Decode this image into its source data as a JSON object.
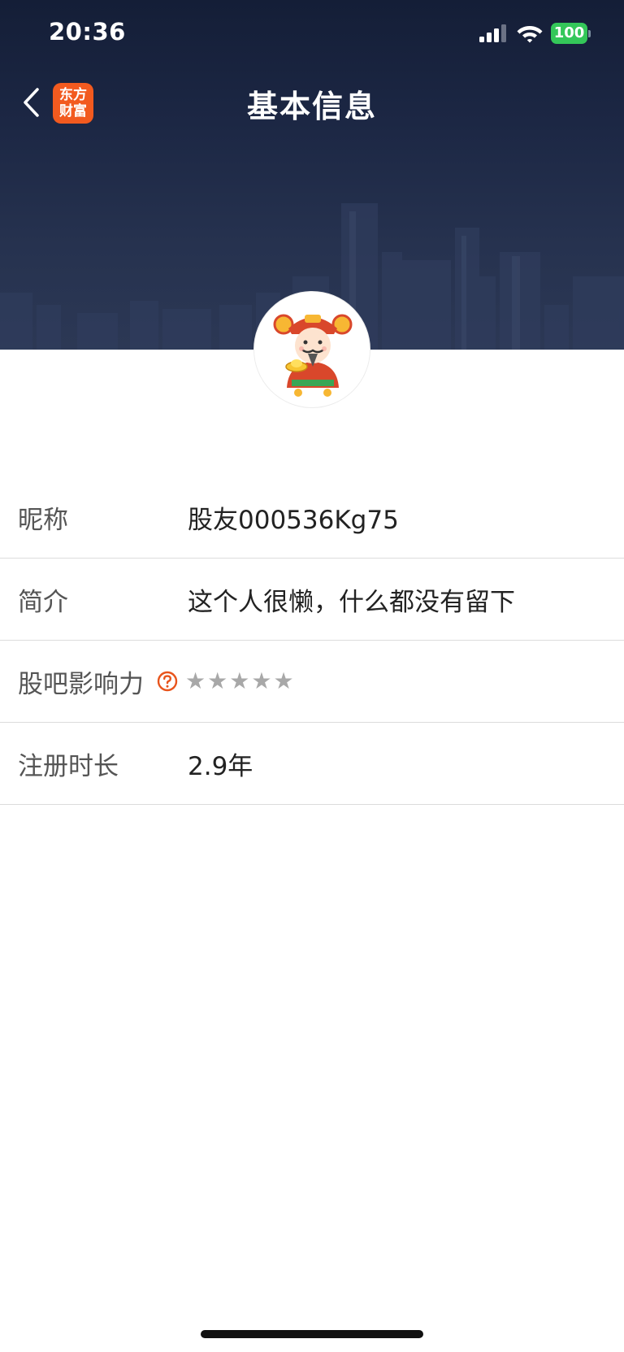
{
  "status_bar": {
    "time": "20:36",
    "battery": "100"
  },
  "nav": {
    "title": "基本信息",
    "app_badge_line1": "东方",
    "app_badge_line2": "财富",
    "back_icon": "chevron-left-icon"
  },
  "profile": {
    "rows": [
      {
        "label": "昵称",
        "value": "股友000536Kg75"
      },
      {
        "label": "简介",
        "value": "这个人很懒，什么都没有留下"
      },
      {
        "label": "股吧影响力",
        "help_icon": "question-circle-icon",
        "rating": 0,
        "max_rating": 5
      },
      {
        "label": "注册时长",
        "value": "2.9年"
      }
    ]
  },
  "colors": {
    "brand": "#f25a1f",
    "header_bg": "#1c2744",
    "battery": "#34c759",
    "star_empty": "#a8a8a8"
  }
}
